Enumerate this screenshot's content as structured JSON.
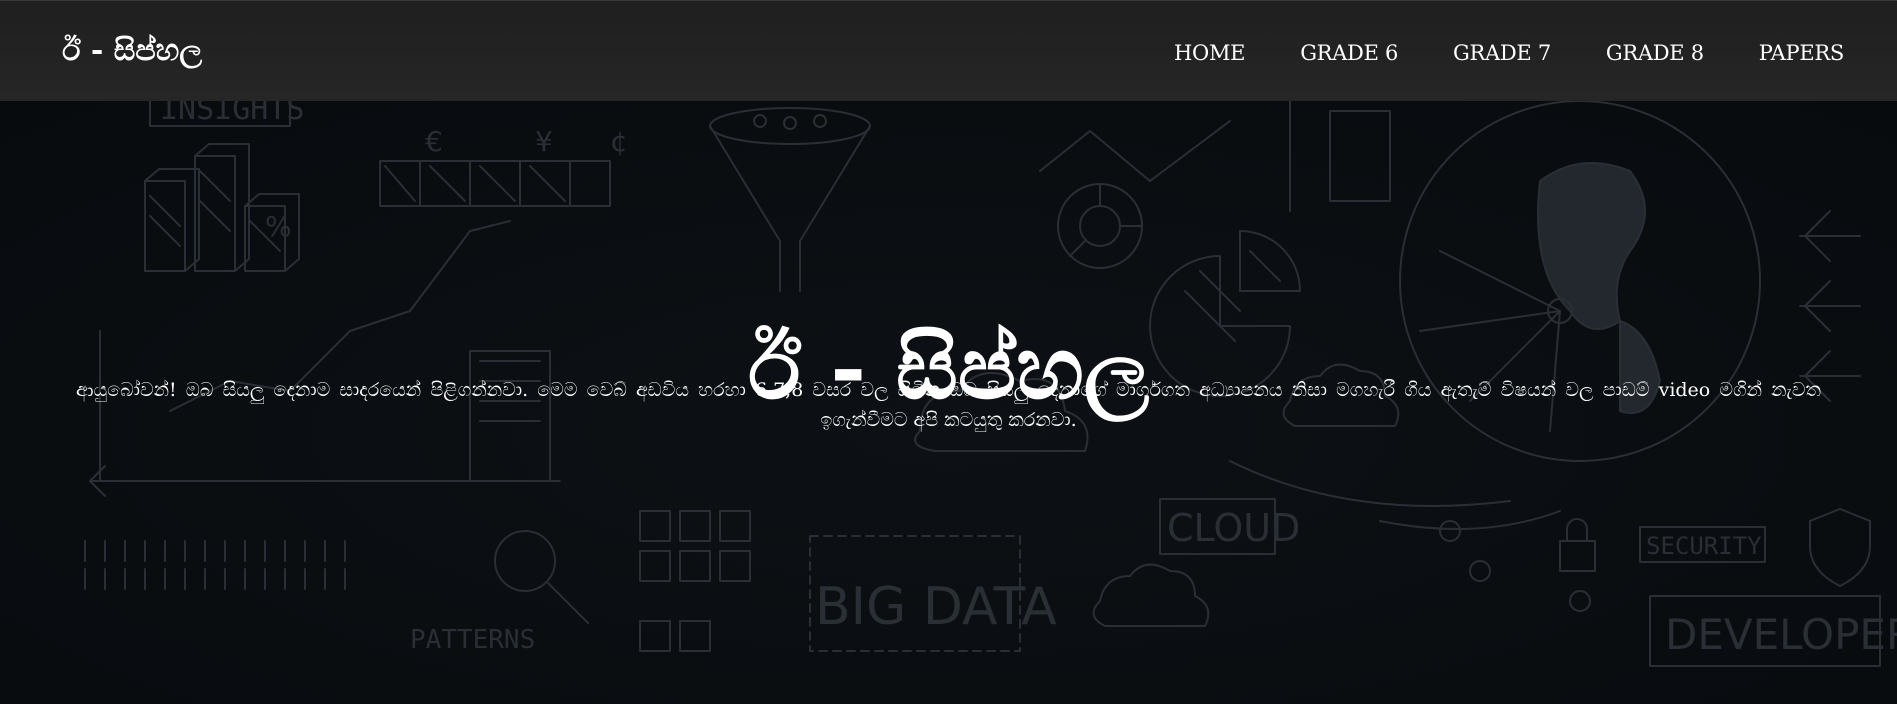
{
  "brand": {
    "title": "ඊ - සිප්හල"
  },
  "nav": {
    "items": [
      {
        "label": "HOME"
      },
      {
        "label": "GRADE 6"
      },
      {
        "label": "GRADE 7"
      },
      {
        "label": "GRADE 8"
      },
      {
        "label": "PAPERS"
      }
    ]
  },
  "hero": {
    "title": "ඊ - සිප්හල",
    "description": "ආයුබෝවන්! ඔබ සියලු දෙනාම සාදරයෙන් පිළිගන්නවා. මෙම වෙබ් අඩවිය හරහා 6,7,8 වසර වල සිටින ඔබ සියලු දෙනාගේ මාර්ගගත අධ්‍යාපනය නිසා මගහැරී ගිය ඇතැම් විෂයන් වල පාඩම් video මගින් නැවත ඉගැන්වීමට අපි කටයුතු කරනවා.",
    "background_words": [
      "INSIGHTS",
      "CLOUD",
      "BIG DATA",
      "PATTERNS",
      "SECURITY",
      "DEVELOPERS"
    ],
    "currency_symbols": [
      "€",
      "¥",
      "¢",
      "%"
    ]
  },
  "colors": {
    "navbar": "#232323",
    "hero_background": "#0a0d10",
    "doodle": "#2a2f35",
    "text": "#ffffff"
  }
}
